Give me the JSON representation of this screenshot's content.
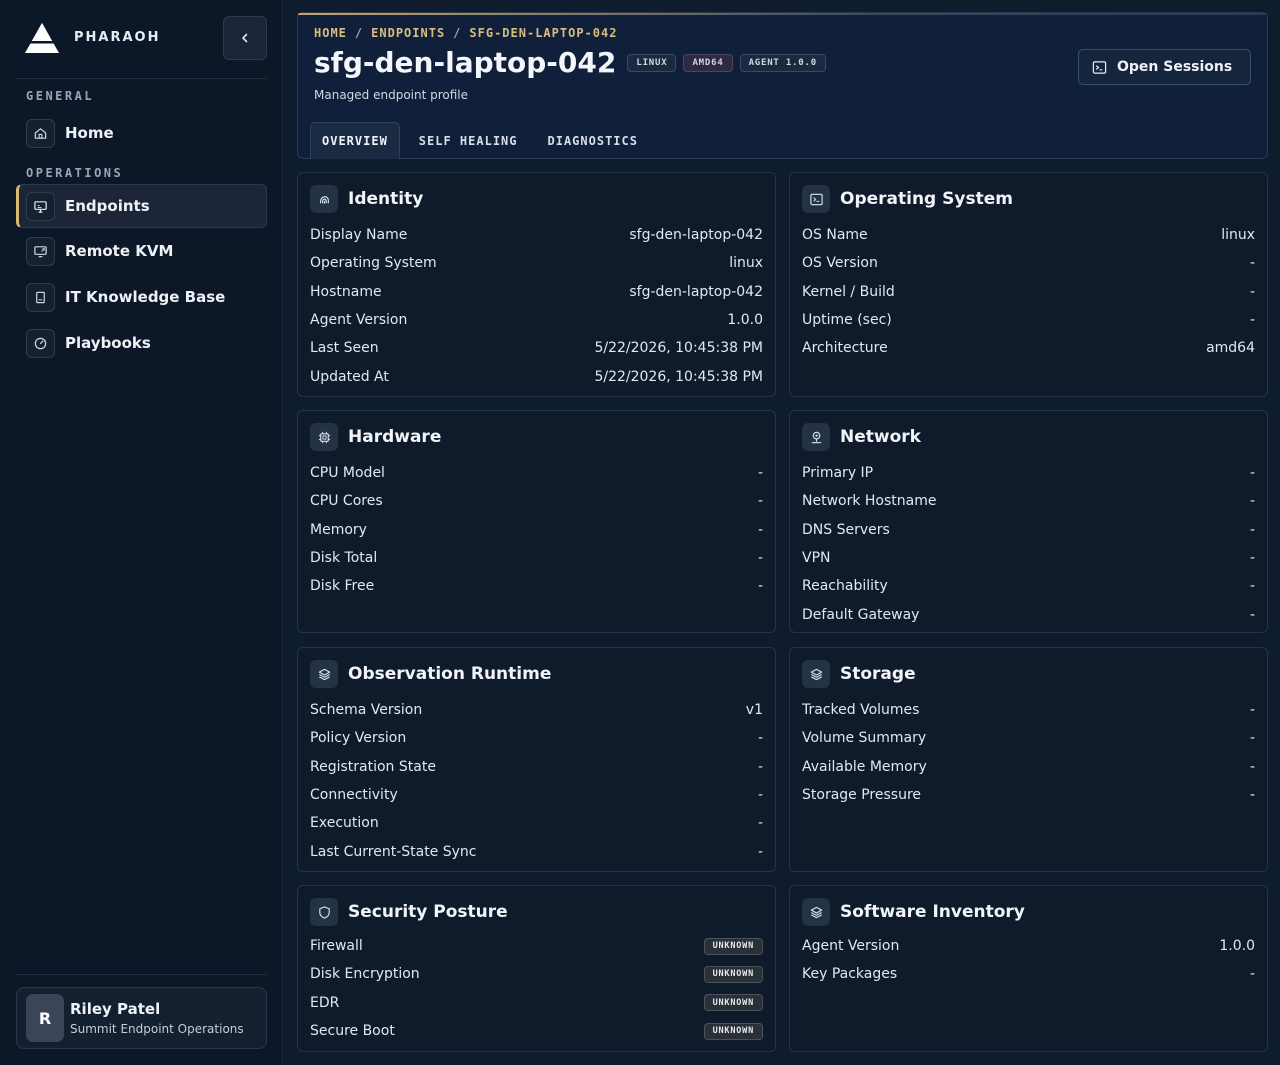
{
  "brand": {
    "name": "PHARAOH"
  },
  "sidebar": {
    "sections": [
      {
        "label": "GENERAL"
      },
      {
        "label": "OPERATIONS"
      }
    ],
    "items": [
      {
        "label": "Home",
        "icon": "home-icon"
      },
      {
        "label": "Endpoints",
        "icon": "monitor-icon",
        "active": true
      },
      {
        "label": "Remote KVM",
        "icon": "remote-screen-icon"
      },
      {
        "label": "IT Knowledge Base",
        "icon": "book-icon"
      },
      {
        "label": "Playbooks",
        "icon": "gauge-icon"
      }
    ],
    "user": {
      "initial": "R",
      "name": "Riley Patel",
      "org": "Summit Endpoint Operations"
    }
  },
  "header": {
    "breadcrumb": [
      "HOME",
      "ENDPOINTS",
      "SFG-DEN-LAPTOP-042"
    ],
    "separator": "/",
    "title": "sfg-den-laptop-042",
    "badges": [
      "LINUX",
      "AMD64",
      "AGENT 1.0.0"
    ],
    "subtitle": "Managed endpoint profile",
    "open_sessions_label": "Open Sessions",
    "tabs": [
      {
        "label": "OVERVIEW",
        "active": true
      },
      {
        "label": "SELF HEALING"
      },
      {
        "label": "DIAGNOSTICS"
      }
    ]
  },
  "cards": {
    "identity": {
      "title": "Identity",
      "rows": [
        {
          "k": "Display Name",
          "v": "sfg-den-laptop-042"
        },
        {
          "k": "Operating System",
          "v": "linux"
        },
        {
          "k": "Hostname",
          "v": "sfg-den-laptop-042"
        },
        {
          "k": "Agent Version",
          "v": "1.0.0"
        },
        {
          "k": "Last Seen",
          "v": "5/22/2026, 10:45:38 PM"
        },
        {
          "k": "Updated At",
          "v": "5/22/2026, 10:45:38 PM"
        }
      ]
    },
    "os": {
      "title": "Operating System",
      "rows": [
        {
          "k": "OS Name",
          "v": "linux"
        },
        {
          "k": "OS Version",
          "v": "-"
        },
        {
          "k": "Kernel / Build",
          "v": "-"
        },
        {
          "k": "Uptime (sec)",
          "v": "-"
        },
        {
          "k": "Architecture",
          "v": "amd64"
        }
      ]
    },
    "hardware": {
      "title": "Hardware",
      "rows": [
        {
          "k": "CPU Model",
          "v": "-"
        },
        {
          "k": "CPU Cores",
          "v": "-"
        },
        {
          "k": "Memory",
          "v": "-"
        },
        {
          "k": "Disk Total",
          "v": "-"
        },
        {
          "k": "Disk Free",
          "v": "-"
        }
      ]
    },
    "network": {
      "title": "Network",
      "rows": [
        {
          "k": "Primary IP",
          "v": "-"
        },
        {
          "k": "Network Hostname",
          "v": "-"
        },
        {
          "k": "DNS Servers",
          "v": "-"
        },
        {
          "k": "VPN",
          "v": "-"
        },
        {
          "k": "Reachability",
          "v": "-"
        },
        {
          "k": "Default Gateway",
          "v": "-"
        }
      ]
    },
    "runtime": {
      "title": "Observation Runtime",
      "rows": [
        {
          "k": "Schema Version",
          "v": "v1"
        },
        {
          "k": "Policy Version",
          "v": "-"
        },
        {
          "k": "Registration State",
          "v": "-"
        },
        {
          "k": "Connectivity",
          "v": "-"
        },
        {
          "k": "Execution",
          "v": "-"
        },
        {
          "k": "Last Current-State Sync",
          "v": "-"
        }
      ]
    },
    "storage": {
      "title": "Storage",
      "rows": [
        {
          "k": "Tracked Volumes",
          "v": "-"
        },
        {
          "k": "Volume Summary",
          "v": "-"
        },
        {
          "k": "Available Memory",
          "v": "-"
        },
        {
          "k": "Storage Pressure",
          "v": "-"
        }
      ]
    },
    "security": {
      "title": "Security Posture",
      "rows": [
        {
          "k": "Firewall",
          "v": "UNKNOWN"
        },
        {
          "k": "Disk Encryption",
          "v": "UNKNOWN"
        },
        {
          "k": "EDR",
          "v": "UNKNOWN"
        },
        {
          "k": "Secure Boot",
          "v": "UNKNOWN"
        }
      ]
    },
    "software": {
      "title": "Software Inventory",
      "rows": [
        {
          "k": "Agent Version",
          "v": "1.0.0"
        },
        {
          "k": "Key Packages",
          "v": "-"
        }
      ]
    }
  },
  "colors": {
    "accent": "#d8bd82",
    "background": "#0f1c2e",
    "sidebar": "#0c1727"
  }
}
